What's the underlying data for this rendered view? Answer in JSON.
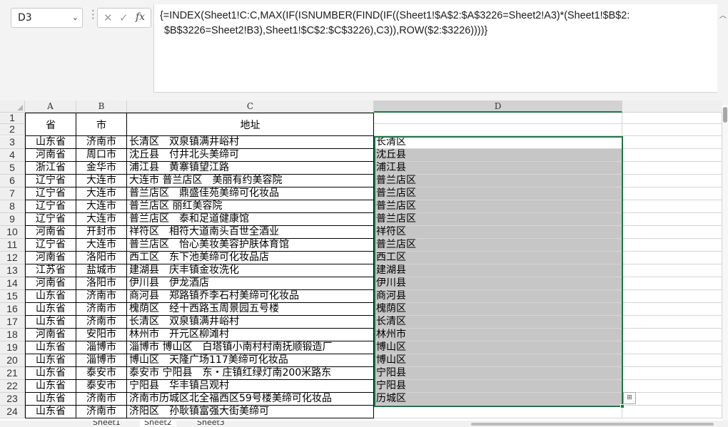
{
  "formula_bar": {
    "name_box": "D3",
    "formula_line1": "{=INDEX(Sheet1!C:C,MAX(IF(ISNUMBER(FIND(IF((Sheet1!$A$2:$A$3226=Sheet2!A3)*(Sheet1!$B$2:",
    "formula_line2": "$B$3226=Sheet2!B3),Sheet1!$C$2:$C$3226),C3)),ROW($2:$3226))))}"
  },
  "columns": [
    "A",
    "B",
    "C",
    "D"
  ],
  "header": {
    "a": "省",
    "b": "市",
    "c": "地址"
  },
  "header_rows": [
    "1",
    "2"
  ],
  "rows": [
    {
      "n": "3",
      "a": "山东省",
      "b": "济南市",
      "c": "长清区　双泉镇满井峪村",
      "d": "长清区"
    },
    {
      "n": "4",
      "a": "河南省",
      "b": "周口市",
      "c": "沈丘县　付井北头美缔可",
      "d": "沈丘县"
    },
    {
      "n": "5",
      "a": "浙江省",
      "b": "金华市",
      "c": "浦江县　黄寨镇望江路",
      "d": "浦江县"
    },
    {
      "n": "6",
      "a": "辽宁省",
      "b": "大连市",
      "c": "大连市 普兰店区　美丽有约美容院",
      "d": "普兰店区"
    },
    {
      "n": "7",
      "a": "辽宁省",
      "b": "大连市",
      "c": "普兰店区　鼎盛佳苑美缔可化妆品",
      "d": "普兰店区"
    },
    {
      "n": "8",
      "a": "辽宁省",
      "b": "大连市",
      "c": "普兰店区 丽红美容院",
      "d": "普兰店区"
    },
    {
      "n": "9",
      "a": "辽宁省",
      "b": "大连市",
      "c": "普兰店区　泰和足道健康馆",
      "d": "普兰店区"
    },
    {
      "n": "10",
      "a": "河南省",
      "b": "开封市",
      "c": "祥符区　相符大道南头百世全酒业",
      "d": "祥符区"
    },
    {
      "n": "11",
      "a": "辽宁省",
      "b": "大连市",
      "c": "普兰店区　怡心美妆美容护肤体育馆",
      "d": "普兰店区"
    },
    {
      "n": "12",
      "a": "河南省",
      "b": "洛阳市",
      "c": "西工区　东下池美缔可化妆品店",
      "d": "西工区"
    },
    {
      "n": "13",
      "a": "江苏省",
      "b": "盐城市",
      "c": "建湖县　庆丰镇金妆洗化",
      "d": "建湖县"
    },
    {
      "n": "14",
      "a": "河南省",
      "b": "洛阳市",
      "c": "伊川县　伊龙酒店",
      "d": "伊川县"
    },
    {
      "n": "15",
      "a": "山东省",
      "b": "济南市",
      "c": "商河县　郑路镇乔李石村美缔可化妆品",
      "d": "商河县"
    },
    {
      "n": "16",
      "a": "山东省",
      "b": "济南市",
      "c": "槐荫区　经十西路玉周景园五号楼",
      "d": "槐荫区"
    },
    {
      "n": "17",
      "a": "山东省",
      "b": "济南市",
      "c": "长清区　双泉镇满井峪村",
      "d": "长清区"
    },
    {
      "n": "18",
      "a": "河南省",
      "b": "安阳市",
      "c": "林州市　开元区柳滩村",
      "d": "林州市"
    },
    {
      "n": "19",
      "a": "山东省",
      "b": "淄博市",
      "c": "淄博市 博山区　白塔镇小南村村南抚顺锻造厂",
      "d": "博山区"
    },
    {
      "n": "20",
      "a": "山东省",
      "b": "淄博市",
      "c": "博山区　天隆广场117美缔可化妆品",
      "d": "博山区"
    },
    {
      "n": "21",
      "a": "山东省",
      "b": "泰安市",
      "c": "泰安市 宁阳县　东・庄镇红绿灯南200米路东",
      "d": "宁阳县"
    },
    {
      "n": "22",
      "a": "山东省",
      "b": "泰安市",
      "c": "宁阳县　华丰镇吕观村",
      "d": "宁阳县"
    },
    {
      "n": "23",
      "a": "山东省",
      "b": "济南市",
      "c": "济南市历城区北全福西区59号楼美缔可化妆品",
      "d": "历城区"
    },
    {
      "n": "24",
      "a": "山东省",
      "b": "济南市",
      "c": "济阳区　孙耿镇富强大街美缔可",
      "d": ""
    }
  ],
  "sheet_tabs": [
    "Sheet1",
    "Sheet2",
    "Sheet3"
  ]
}
